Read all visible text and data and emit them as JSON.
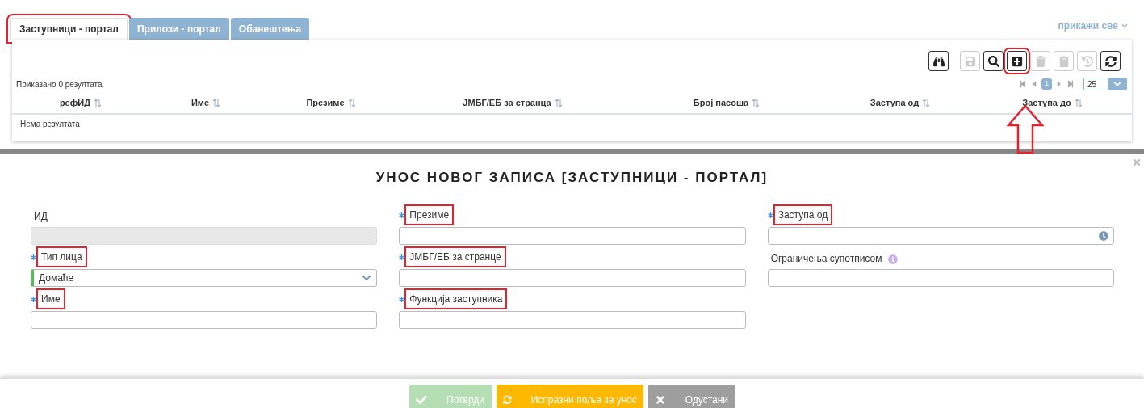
{
  "tabs": [
    {
      "label": "Заступници - портал",
      "selected": true,
      "highlighted": true
    },
    {
      "label": "Прилози - портал",
      "selected": false,
      "highlighted": false
    },
    {
      "label": "Обавештења",
      "selected": false,
      "highlighted": false
    }
  ],
  "show_all": "прикажи све",
  "toolbar": [
    {
      "kind": "binoculars",
      "disabled": false,
      "highlighted": false
    },
    {
      "kind": "save",
      "disabled": true,
      "highlighted": false
    },
    {
      "kind": "search",
      "disabled": false,
      "highlighted": false
    },
    {
      "kind": "add",
      "disabled": false,
      "highlighted": true
    },
    {
      "kind": "delete",
      "disabled": true,
      "highlighted": false
    },
    {
      "kind": "clipboard",
      "disabled": true,
      "highlighted": false
    },
    {
      "kind": "history",
      "disabled": true,
      "highlighted": false
    },
    {
      "kind": "refresh",
      "disabled": false,
      "highlighted": false
    }
  ],
  "result_count": "Приказано 0 резултата",
  "pagination": {
    "pages": [
      {
        "label": "1",
        "selected": true
      }
    ],
    "page_size": "25"
  },
  "table": {
    "columns": [
      "рефИД",
      "Име",
      "Презиме",
      "ЈМБГ/ЕБ за странца",
      "Број пасоша",
      "Заступа од",
      "Заступа до"
    ],
    "empty_text": "Нема резултата"
  },
  "dialog": {
    "title": "УНОС НОВОГ ЗАПИСА [ЗАСТУПНИЦИ - ПОРТАЛ]",
    "columns": [
      [
        {
          "kind": "text",
          "label": "ИД",
          "required": false,
          "disabled": true,
          "highlighted": false
        },
        {
          "kind": "select",
          "label": "Тип лица",
          "value": "Домаће",
          "required": true,
          "disabled": false,
          "highlighted": true
        },
        {
          "kind": "text",
          "label": "Име",
          "required": true,
          "disabled": false,
          "highlighted": true
        }
      ],
      [
        {
          "kind": "text",
          "label": "Презиме",
          "required": true,
          "disabled": false,
          "highlighted": true
        },
        {
          "kind": "text",
          "label": "ЈМБГ/ЕБ за странце",
          "required": true,
          "disabled": false,
          "highlighted": true
        },
        {
          "kind": "text",
          "label": "Функција заступника",
          "required": true,
          "disabled": false,
          "highlighted": true
        }
      ],
      [
        {
          "kind": "datetime",
          "label": "Заступа од",
          "required": true,
          "disabled": false,
          "highlighted": true
        },
        {
          "kind": "text",
          "label": "Ограничења супотписом",
          "required": false,
          "disabled": false,
          "highlighted": false,
          "info": true
        }
      ]
    ],
    "buttons": [
      {
        "kind": "confirm",
        "label": "Потврди",
        "disabled": true
      },
      {
        "kind": "clear",
        "label": "Испразни поља за унос",
        "disabled": false
      },
      {
        "kind": "cancel",
        "label": "Одустани",
        "disabled": false
      }
    ]
  }
}
